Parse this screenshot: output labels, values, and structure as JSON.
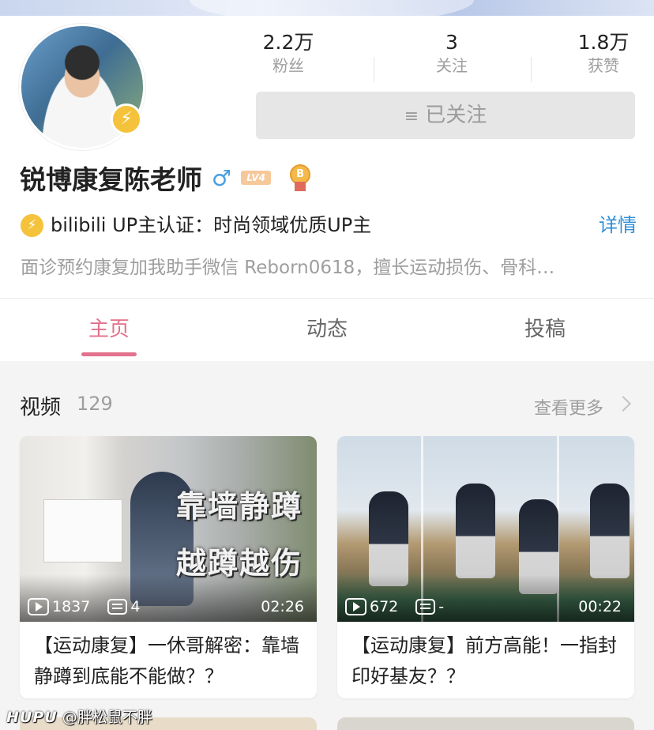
{
  "profile": {
    "stats": [
      {
        "value": "2.2万",
        "label": "粉丝"
      },
      {
        "value": "3",
        "label": "关注"
      },
      {
        "value": "1.8万",
        "label": "获赞"
      }
    ],
    "follow_button": "已关注",
    "follow_icon": "≡",
    "name": "锐博康复陈老师",
    "gender_icon": "♂",
    "level": "LV4",
    "medal_letter": "B",
    "cert_icon": "⚡",
    "certification": "bilibili  UP主认证：时尚领域优质UP主",
    "detail_link": "详情",
    "bio": "面诊预约康复加我助手微信  Reborn0618，擅长运动损伤、骨科…"
  },
  "tabs": [
    {
      "label": "主页",
      "active": true
    },
    {
      "label": "动态",
      "active": false
    },
    {
      "label": "投稿",
      "active": false
    }
  ],
  "videos_section": {
    "title": "视频",
    "count": "129",
    "more": "查看更多"
  },
  "videos": [
    {
      "thumb_caption_1": "靠墙静蹲",
      "thumb_caption_2": "越蹲越伤",
      "views": "1837",
      "danmaku": "4",
      "duration": "02:26",
      "title": "【运动康复】一休哥解密：靠墙静蹲到底能不能做？？"
    },
    {
      "views": "672",
      "danmaku": "-",
      "duration": "00:22",
      "title": "【运动康复】前方高能！一指封印好基友？？"
    }
  ],
  "watermark": {
    "brand": "HUPU",
    "user": "@胖松鼠不胖"
  },
  "colors": {
    "accent_pink": "#e2718c",
    "link_blue": "#2e8fd8",
    "verify_yellow": "#f5c23b"
  }
}
